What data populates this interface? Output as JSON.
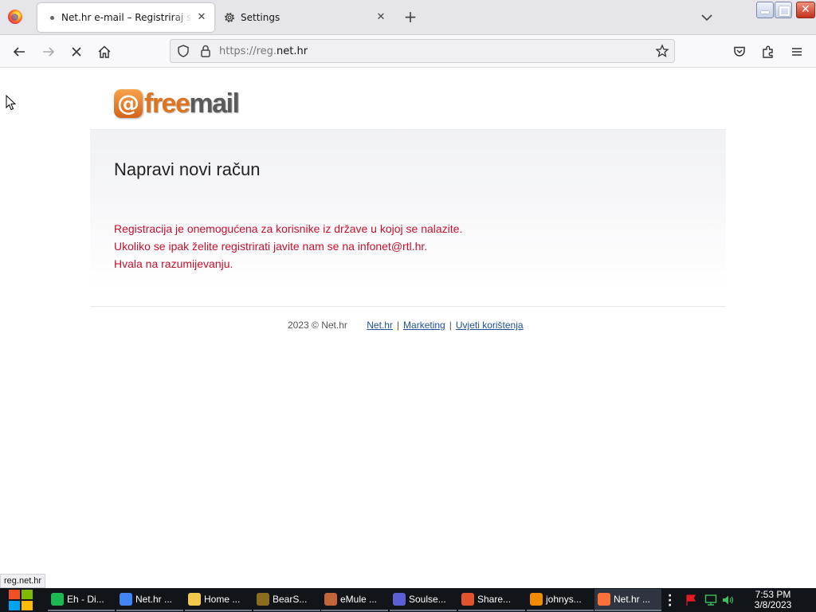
{
  "browser": {
    "tabs": [
      {
        "title": "Net.hr e-mail – Registriraj se",
        "active": true
      },
      {
        "title": "Settings",
        "active": false
      }
    ],
    "url": {
      "prefix": "https://reg.",
      "domain": "net.hr"
    }
  },
  "page": {
    "logo": {
      "at": "@",
      "free": "free",
      "mail": "mail"
    },
    "heading": "Napravi novi račun",
    "message_lines": [
      "Registracija je onemogućena za korisnike iz države u kojoj se nalazite.",
      "Ukoliko se ipak želite registrirati javite nam se na infonet@rtl.hr.",
      "Hvala na razumijevanju."
    ],
    "footer": {
      "copyright": "2023 © Net.hr",
      "links": [
        "Net.hr",
        "Marketing",
        "Uvjeti korištenja"
      ]
    },
    "status_link": "reg.net.hr"
  },
  "taskbar": {
    "items": [
      {
        "label": "Eh - Di...",
        "icon": "spotify-icon",
        "color": "#1db954"
      },
      {
        "label": "Net.hr ...",
        "icon": "chrome-icon",
        "color": "#4285f4"
      },
      {
        "label": "Home ...",
        "icon": "folder-icon",
        "color": "#f2c94c"
      },
      {
        "label": "BearS...",
        "icon": "bearshare-icon",
        "color": "#8a6d1f"
      },
      {
        "label": "eMule ...",
        "icon": "emule-icon",
        "color": "#c2653a"
      },
      {
        "label": "Soulse...",
        "icon": "soulseek-icon",
        "color": "#5a5fd6"
      },
      {
        "label": "Share...",
        "icon": "shareaza-icon",
        "color": "#e0532c"
      },
      {
        "label": "johnys...",
        "icon": "vlc-icon",
        "color": "#f08c00"
      },
      {
        "label": "Net.hr ...",
        "icon": "firefox-icon",
        "color": "#ff7139"
      }
    ],
    "clock": {
      "time": "7:53 PM",
      "date": "3/8/2023"
    }
  }
}
